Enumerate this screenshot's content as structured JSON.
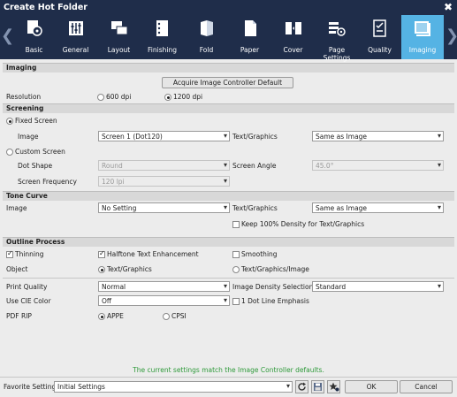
{
  "window": {
    "title": "Create Hot Folder",
    "close_glyph": "✖"
  },
  "tabs": [
    {
      "label": "Basic",
      "icon": "basic-icon"
    },
    {
      "label": "General",
      "icon": "general-icon"
    },
    {
      "label": "Layout",
      "icon": "layout-icon"
    },
    {
      "label": "Finishing",
      "icon": "finishing-icon"
    },
    {
      "label": "Fold",
      "icon": "fold-icon"
    },
    {
      "label": "Paper",
      "icon": "paper-icon"
    },
    {
      "label": "Cover",
      "icon": "cover-icon"
    },
    {
      "label": "Page Settings",
      "icon": "page-settings-icon"
    },
    {
      "label": "Quality",
      "icon": "quality-icon"
    },
    {
      "label": "Imaging",
      "icon": "imaging-icon",
      "active": true
    }
  ],
  "imaging": {
    "header": "Imaging",
    "acquire_button": "Acquire Image Controller Default",
    "resolution": {
      "label": "Resolution",
      "options": [
        "600 dpi",
        "1200 dpi"
      ],
      "selected": "1200 dpi"
    }
  },
  "screening": {
    "header": "Screening",
    "fixed_screen": "Fixed Screen",
    "image_label": "Image",
    "image_value": "Screen 1 (Dot120)",
    "text_graphics_label": "Text/Graphics",
    "text_graphics_value": "Same as Image",
    "custom_screen": "Custom Screen",
    "dot_shape_label": "Dot Shape",
    "dot_shape_value": "Round",
    "screen_angle_label": "Screen Angle",
    "screen_angle_value": "45.0°",
    "screen_frequency_label": "Screen Frequency",
    "screen_frequency_value": "120 lpi",
    "selected": "Fixed Screen"
  },
  "tone_curve": {
    "header": "Tone Curve",
    "image_label": "Image",
    "image_value": "No Setting",
    "text_graphics_label": "Text/Graphics",
    "text_graphics_value": "Same as Image",
    "keep_density": "Keep 100% Density for Text/Graphics",
    "keep_density_checked": false
  },
  "outline_process": {
    "header": "Outline Process",
    "thinning": "Thinning",
    "thinning_checked": true,
    "halftone": "Halftone Text Enhancement",
    "halftone_checked": true,
    "smoothing": "Smoothing",
    "smoothing_checked": false,
    "object_label": "Object",
    "object_options": [
      "Text/Graphics",
      "Text/Graphics/Image"
    ],
    "object_selected": "Text/Graphics"
  },
  "quality": {
    "print_quality_label": "Print Quality",
    "print_quality_value": "Normal",
    "density_label": "Image Density Selection",
    "density_value": "Standard",
    "cie_label": "Use CIE Color",
    "cie_value": "Off",
    "one_dot": "1 Dot Line Emphasis",
    "one_dot_checked": false,
    "pdf_rip_label": "PDF RIP",
    "pdf_rip_options": [
      "APPE",
      "CPSI"
    ],
    "pdf_rip_selected": "APPE"
  },
  "status_text": "The current settings match the Image Controller defaults.",
  "footer": {
    "favorite_label": "Favorite Setting",
    "favorite_value": "Initial Settings",
    "ok": "OK",
    "cancel": "Cancel"
  },
  "colors": {
    "title_bar": "#1f2d4a",
    "active_tab": "#55b3e4",
    "status_green": "#2e9a3a"
  }
}
